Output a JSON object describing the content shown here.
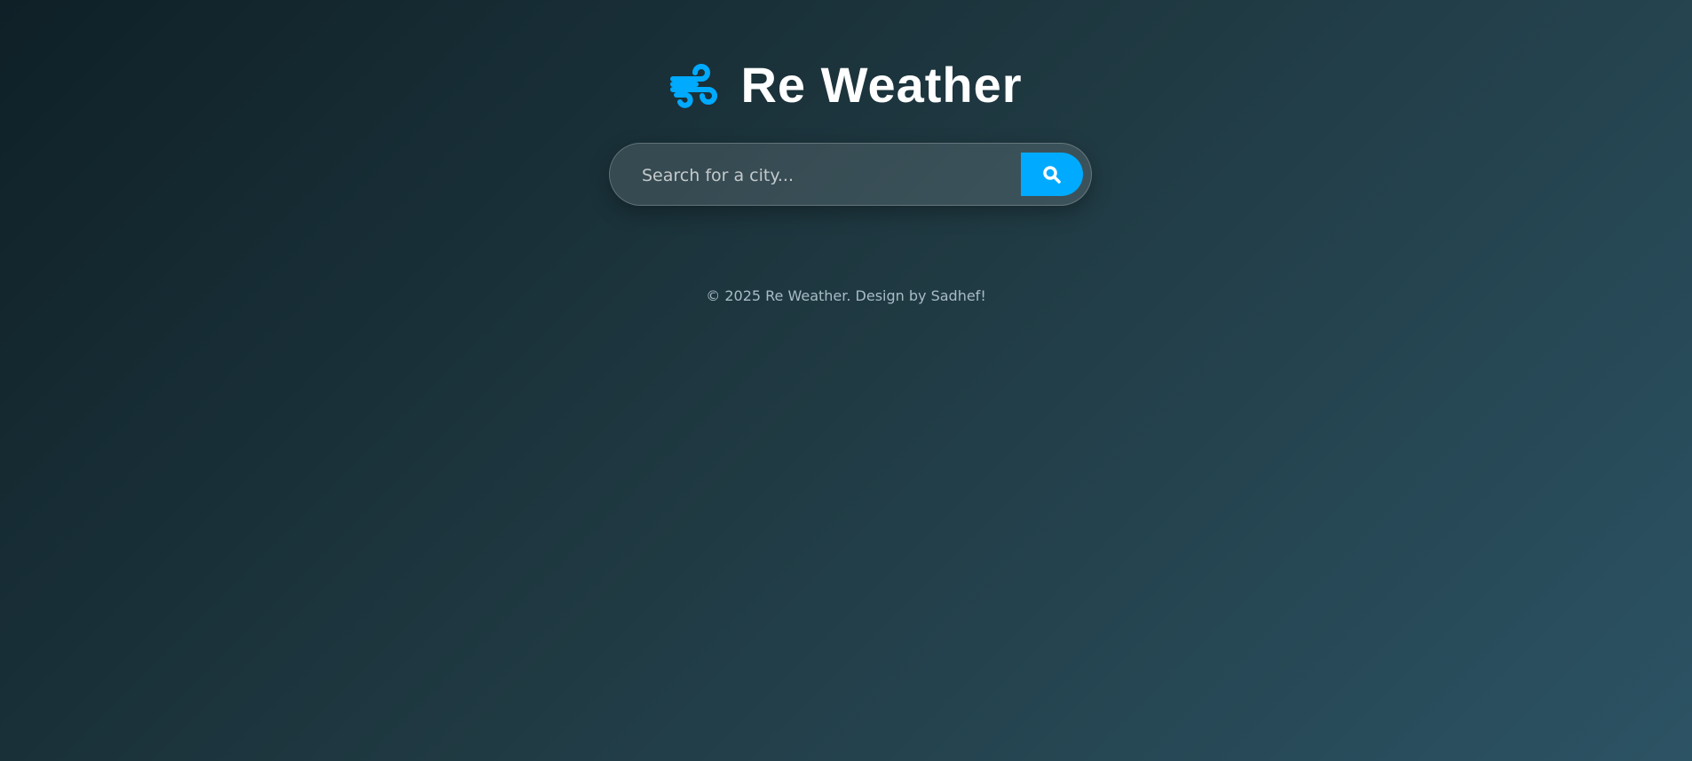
{
  "header": {
    "title": "Re Weather",
    "icon": "wind-icon",
    "accent": "#00aaff"
  },
  "search": {
    "placeholder": "Search for a city...",
    "value": "",
    "button_icon": "search-icon"
  },
  "footer": {
    "text": "© 2025 Re Weather. Design by Sadhef!"
  }
}
